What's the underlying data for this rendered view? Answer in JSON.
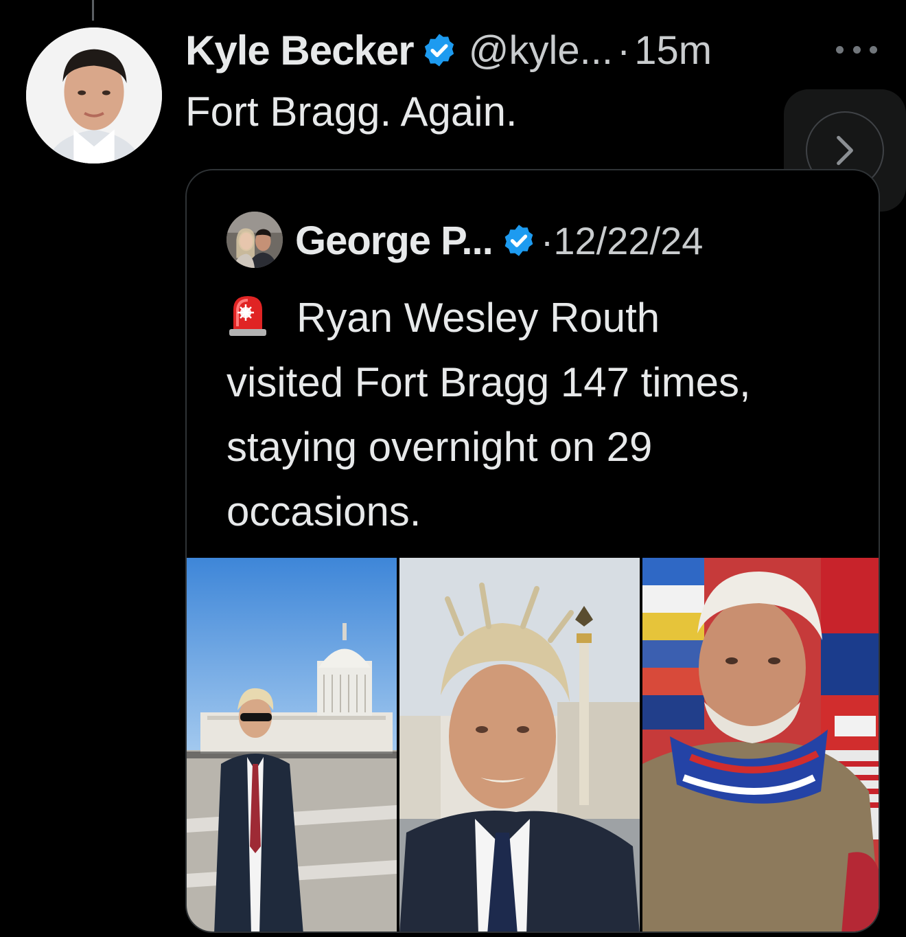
{
  "tweet": {
    "author_name": "Kyle Becker",
    "handle": "@kyle...",
    "separator": "·",
    "time": "15m",
    "text": "Fort Bragg. Again."
  },
  "quoted_tweet": {
    "author_name": "George P...",
    "separator": "·",
    "date": "12/22/24",
    "lines": [
      "Ryan Wesley Routh",
      "visited Fort Bragg 147 times,",
      "staying overnight on 29",
      "occasions."
    ]
  },
  "icons": {
    "verified": "verified-badge-icon",
    "more": "more-dots-icon",
    "next": "chevron-right-icon",
    "siren": "police-siren-emoji-icon"
  },
  "colors": {
    "background": "#000000",
    "text_primary": "#e7e9ea",
    "text_secondary": "#c9ccce",
    "verified_blue": "#1d9bf0",
    "border": "#2f3336"
  }
}
